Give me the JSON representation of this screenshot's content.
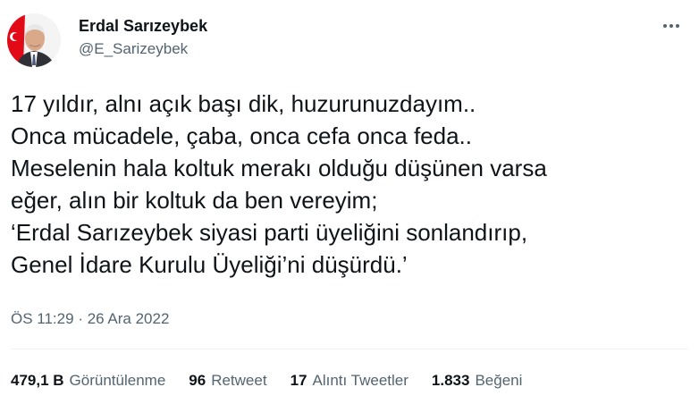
{
  "author": {
    "display_name": "Erdal Sarızeybek",
    "handle": "@E_Sarizeybek",
    "avatar_icon": "profile-photo-with-flag"
  },
  "more_icon": "more-horizontal-icon",
  "tweet": {
    "lines": [
      "17 yıldır, alnı açık başı dik, huzurunuzdayım..",
      "Onca mücadele, çaba, onca cefa onca feda..",
      "Meselenin hala koltuk merakı olduğu düşünen varsa",
      "eğer, alın bir koltuk da ben vereyim;",
      "‘Erdal Sarızeybek siyasi parti üyeliğini sonlandırıp,",
      "Genel İdare Kurulu Üyeliği’ni düşürdü.’"
    ]
  },
  "meta": {
    "time": "ÖS 11:29",
    "separator": "·",
    "date": "26 Ara 2022"
  },
  "stats": [
    {
      "value": "479,1 B",
      "label": "Görüntülenme"
    },
    {
      "value": "96",
      "label": "Retweet"
    },
    {
      "value": "17",
      "label": "Alıntı Tweetler"
    },
    {
      "value": "1.833",
      "label": "Beğeni"
    }
  ],
  "colors": {
    "text": "#0f1419",
    "secondary": "#536471",
    "divider": "#eff3f4",
    "flag_red": "#e30a17"
  }
}
